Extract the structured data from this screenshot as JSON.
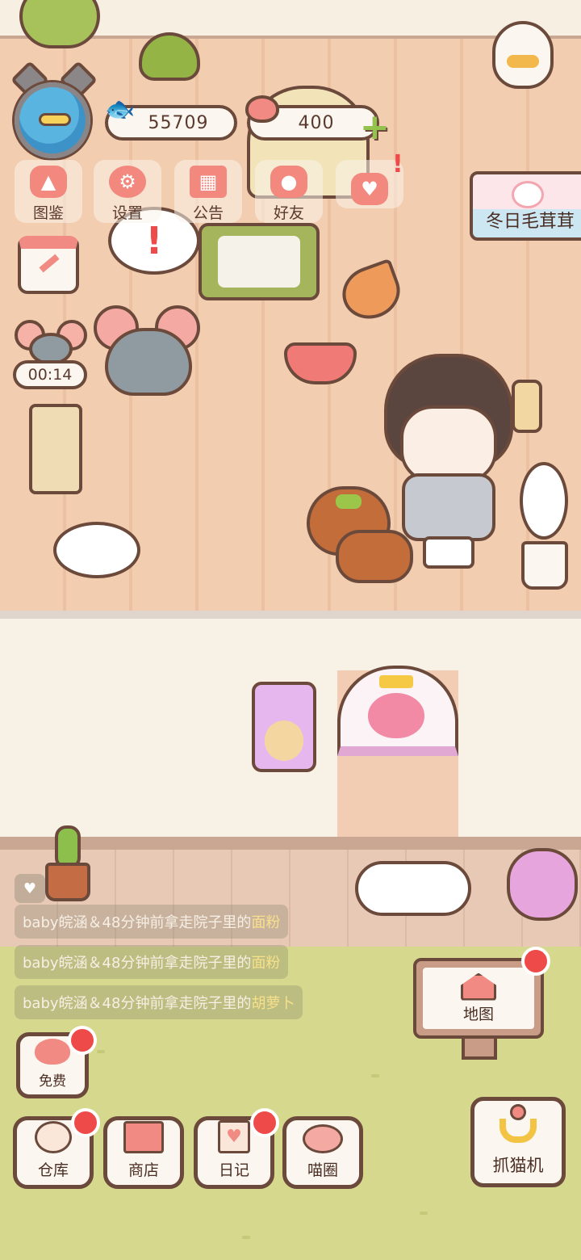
{
  "hud": {
    "fish_currency": "55709",
    "heart_currency": "400",
    "menu": [
      {
        "label": "图鉴"
      },
      {
        "label": "设置"
      },
      {
        "label": "公告"
      },
      {
        "label": "好友"
      }
    ],
    "event_banner": "冬日毛茸茸",
    "timer": "00:14"
  },
  "feed": [
    {
      "prefix": "baby皖涵＆48分钟前拿走院子里的",
      "item": "面粉"
    },
    {
      "prefix": "baby皖涵＆48分钟前拿走院子里的",
      "item": "面粉"
    },
    {
      "prefix": "baby皖涵＆48分钟前拿走院子里的",
      "item": "胡萝卜"
    }
  ],
  "bottom": {
    "free": "免费",
    "warehouse": "仓库",
    "shop": "商店",
    "diary": "日记",
    "meow_circle": "喵圈",
    "map": "地图",
    "claw_machine": "抓猫机"
  },
  "colors": {
    "outline": "#6b4a3c",
    "floor": "#f3cdb0",
    "lawn": "#d6d88d",
    "accent_pink": "#f08a82",
    "badge_red": "#ee4a4a",
    "feed_highlight": "#f8e08a"
  }
}
